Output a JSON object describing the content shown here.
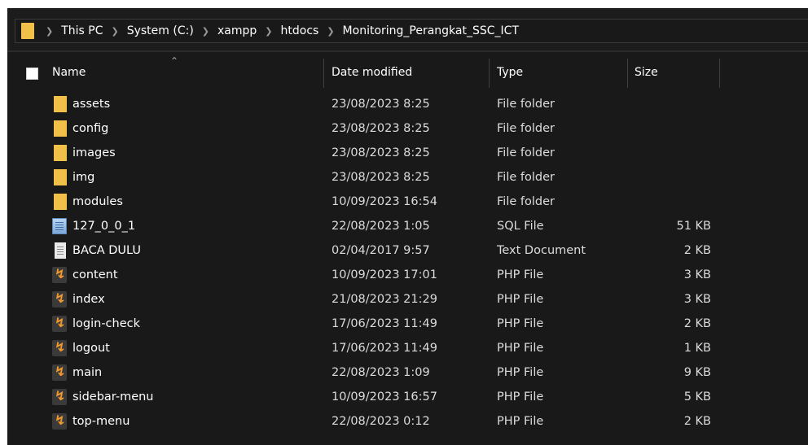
{
  "breadcrumb": [
    "This PC",
    "System (C:)",
    "xampp",
    "htdocs",
    "Monitoring_Perangkat_SSC_ICT"
  ],
  "columns": {
    "name": "Name",
    "date": "Date modified",
    "type": "Type",
    "size": "Size"
  },
  "files": [
    {
      "name": "assets",
      "date": "23/08/2023 8:25",
      "type": "File folder",
      "size": "",
      "icon": "folder-icon"
    },
    {
      "name": "config",
      "date": "23/08/2023 8:25",
      "type": "File folder",
      "size": "",
      "icon": "folder-icon"
    },
    {
      "name": "images",
      "date": "23/08/2023 8:25",
      "type": "File folder",
      "size": "",
      "icon": "folder-icon"
    },
    {
      "name": "img",
      "date": "23/08/2023 8:25",
      "type": "File folder",
      "size": "",
      "icon": "folder-icon"
    },
    {
      "name": "modules",
      "date": "10/09/2023 16:54",
      "type": "File folder",
      "size": "",
      "icon": "folder-icon"
    },
    {
      "name": "127_0_0_1",
      "date": "22/08/2023 1:05",
      "type": "SQL File",
      "size": "51 KB",
      "icon": "sql-file-icon"
    },
    {
      "name": "BACA DULU",
      "date": "02/04/2017 9:57",
      "type": "Text Document",
      "size": "2 KB",
      "icon": "text-file-icon"
    },
    {
      "name": "content",
      "date": "10/09/2023 17:01",
      "type": "PHP File",
      "size": "3 KB",
      "icon": "php-file-icon"
    },
    {
      "name": "index",
      "date": "21/08/2023 21:29",
      "type": "PHP File",
      "size": "3 KB",
      "icon": "php-file-icon"
    },
    {
      "name": "login-check",
      "date": "17/06/2023 11:49",
      "type": "PHP File",
      "size": "2 KB",
      "icon": "php-file-icon"
    },
    {
      "name": "logout",
      "date": "17/06/2023 11:49",
      "type": "PHP File",
      "size": "1 KB",
      "icon": "php-file-icon"
    },
    {
      "name": "main",
      "date": "22/08/2023 1:09",
      "type": "PHP File",
      "size": "9 KB",
      "icon": "php-file-icon"
    },
    {
      "name": "sidebar-menu",
      "date": "10/09/2023 16:57",
      "type": "PHP File",
      "size": "5 KB",
      "icon": "php-file-icon"
    },
    {
      "name": "top-menu",
      "date": "22/08/2023 0:12",
      "type": "PHP File",
      "size": "2 KB",
      "icon": "php-file-icon"
    }
  ],
  "colors": {
    "background": "#191919",
    "folder": "#f1c048",
    "php_accent": "#f29a2e"
  }
}
